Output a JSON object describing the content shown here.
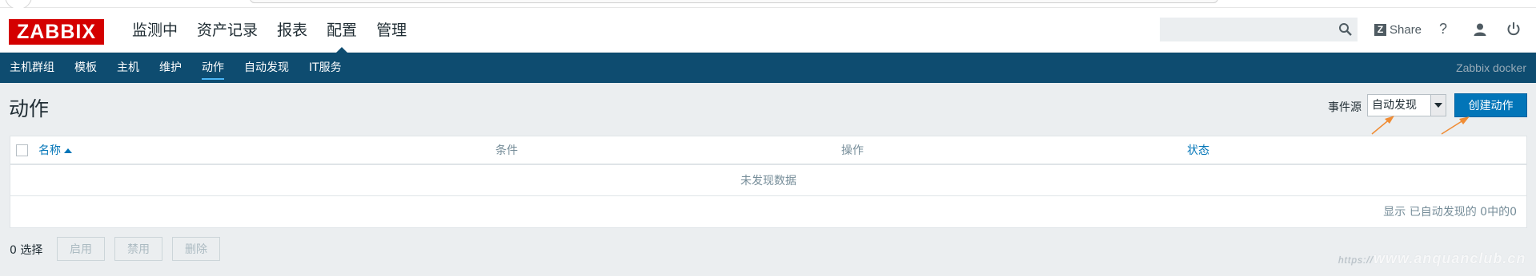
{
  "topnav": {
    "logo": "ZABBIX",
    "menu": [
      "监测中",
      "资产记录",
      "报表",
      "配置",
      "管理"
    ],
    "share_label": "Share",
    "share_logo": "Z",
    "help_label": "?"
  },
  "subnav": {
    "items": [
      "主机群组",
      "模板",
      "主机",
      "维护",
      "动作",
      "自动发现",
      "IT服务"
    ],
    "server_name": "Zabbix docker"
  },
  "page": {
    "title": "动作",
    "event_source_label": "事件源",
    "event_source_value": "自动发现",
    "create_button": "创建动作"
  },
  "table": {
    "columns": [
      "名称",
      "条件",
      "操作",
      "状态"
    ],
    "empty_text": "未发现数据",
    "footer_text": "显示 已自动发现的 0中的0"
  },
  "actions": {
    "selected_text": "0 选择",
    "buttons": [
      "启用",
      "禁用",
      "删除"
    ]
  },
  "watermark": {
    "prefix": "https://",
    "text": "www.anquanclub.cn"
  },
  "colors": {
    "brand_red": "#d40000",
    "nav_blue": "#0e4c70",
    "primary_button": "#0275b8",
    "annotation_arrow": "#f08c34"
  }
}
